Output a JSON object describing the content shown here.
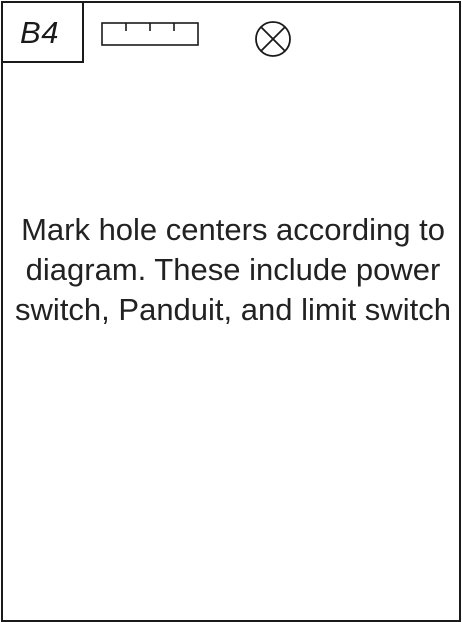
{
  "step": {
    "label": "B4"
  },
  "icons": {
    "tool": "ruler-icon",
    "marker": "circle-x-icon"
  },
  "instruction": {
    "text": "Mark hole centers according to diagram. These include power switch, Panduit, and limit switch"
  },
  "colors": {
    "stroke": "#1a1a1a",
    "background": "#ffffff"
  }
}
